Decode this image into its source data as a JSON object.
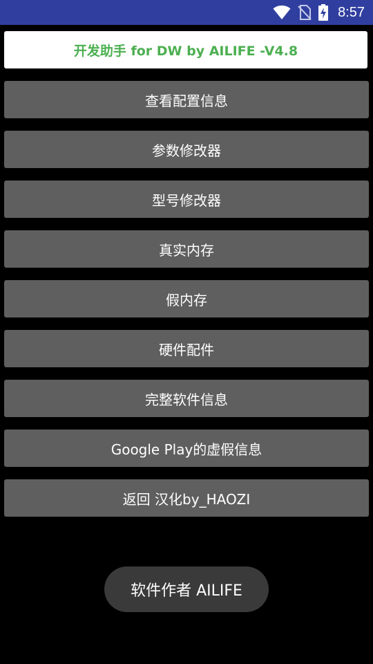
{
  "status_bar": {
    "time": "8:57",
    "icons": [
      "wifi-icon",
      "no-sim-icon",
      "battery-charging-icon"
    ]
  },
  "app": {
    "title": "开发助手 for DW by AILIFE -V4.8",
    "title_color": "#4caf50",
    "menu": [
      {
        "label": "查看配置信息"
      },
      {
        "label": "参数修改器"
      },
      {
        "label": "型号修改器"
      },
      {
        "label": "真实内存"
      },
      {
        "label": "假内存"
      },
      {
        "label": "硬件配件"
      },
      {
        "label": "完整软件信息"
      },
      {
        "label": "Google Play的虚假信息"
      },
      {
        "label": "返回 汉化by_HAOZI"
      }
    ]
  },
  "toast": {
    "text": "软件作者 AILIFE"
  },
  "colors": {
    "status_bar": "#303f9f",
    "background": "#000000",
    "button": "#5f5f5f",
    "toast": "#3a3a3a"
  }
}
